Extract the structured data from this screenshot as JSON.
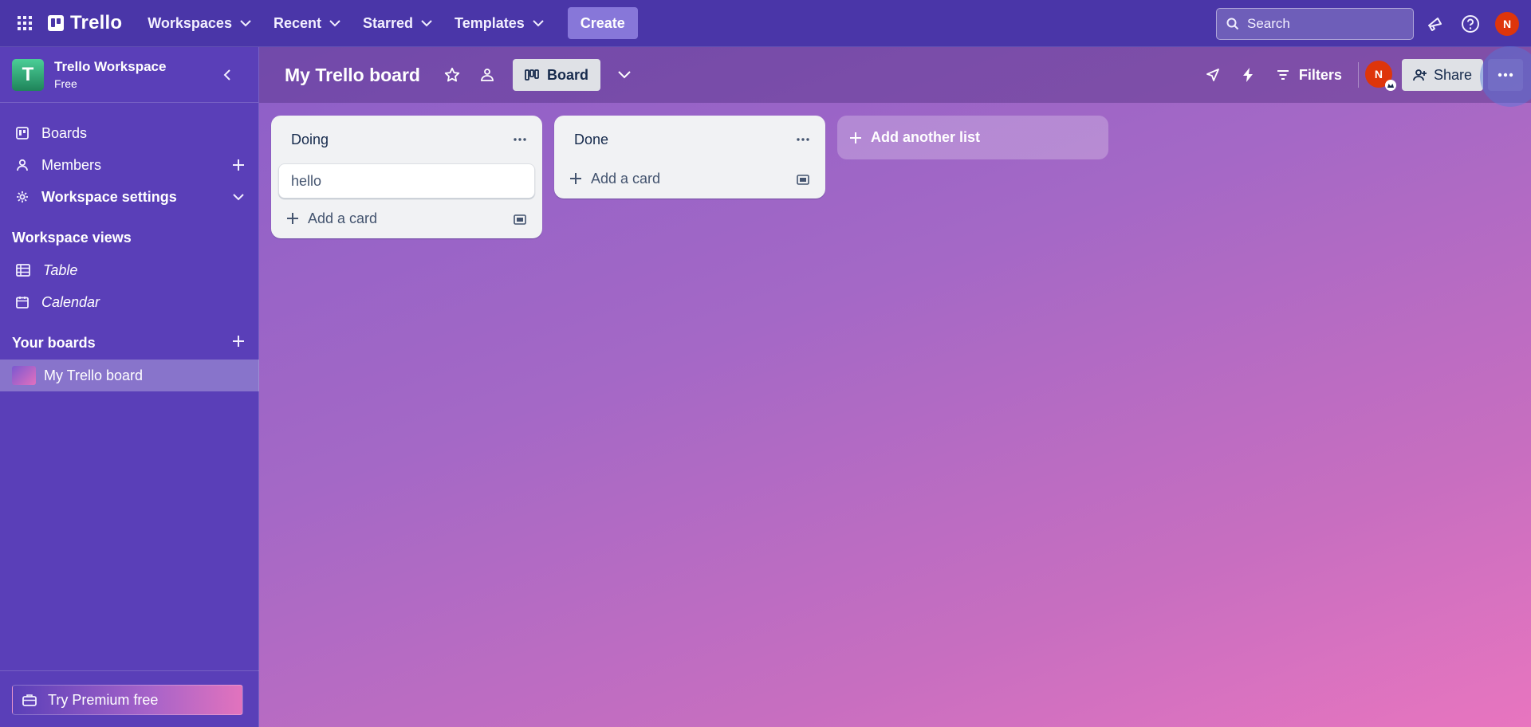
{
  "topnav": {
    "logo": "Trello",
    "menus": [
      {
        "label": "Workspaces"
      },
      {
        "label": "Recent"
      },
      {
        "label": "Starred"
      },
      {
        "label": "Templates"
      }
    ],
    "create_label": "Create",
    "search_placeholder": "Search",
    "avatar_initial": "N"
  },
  "sidebar": {
    "workspace_initial": "T",
    "workspace_name": "Trello Workspace",
    "workspace_plan": "Free",
    "items": [
      {
        "label": "Boards"
      },
      {
        "label": "Members"
      },
      {
        "label": "Workspace settings"
      }
    ],
    "views_heading": "Workspace views",
    "views": [
      {
        "label": "Table"
      },
      {
        "label": "Calendar"
      }
    ],
    "boards_heading": "Your boards",
    "boards": [
      {
        "label": "My Trello board"
      }
    ],
    "premium_label": "Try Premium free"
  },
  "board": {
    "title": "My Trello board",
    "view_label": "Board",
    "filters_label": "Filters",
    "member_initial": "N",
    "share_label": "Share",
    "lists": [
      {
        "title": "Doing",
        "cards": [
          "hello"
        ],
        "add_card_label": "Add a card"
      },
      {
        "title": "Done",
        "cards": [],
        "add_card_label": "Add a card"
      }
    ],
    "add_list_label": "Add another list"
  },
  "colors": {
    "topbar": "#4a36a8",
    "sidebar": "#5a3fb8",
    "accent_create": "#8777d9",
    "avatar": "#de350b",
    "workspace_logo": "#1f845a"
  }
}
